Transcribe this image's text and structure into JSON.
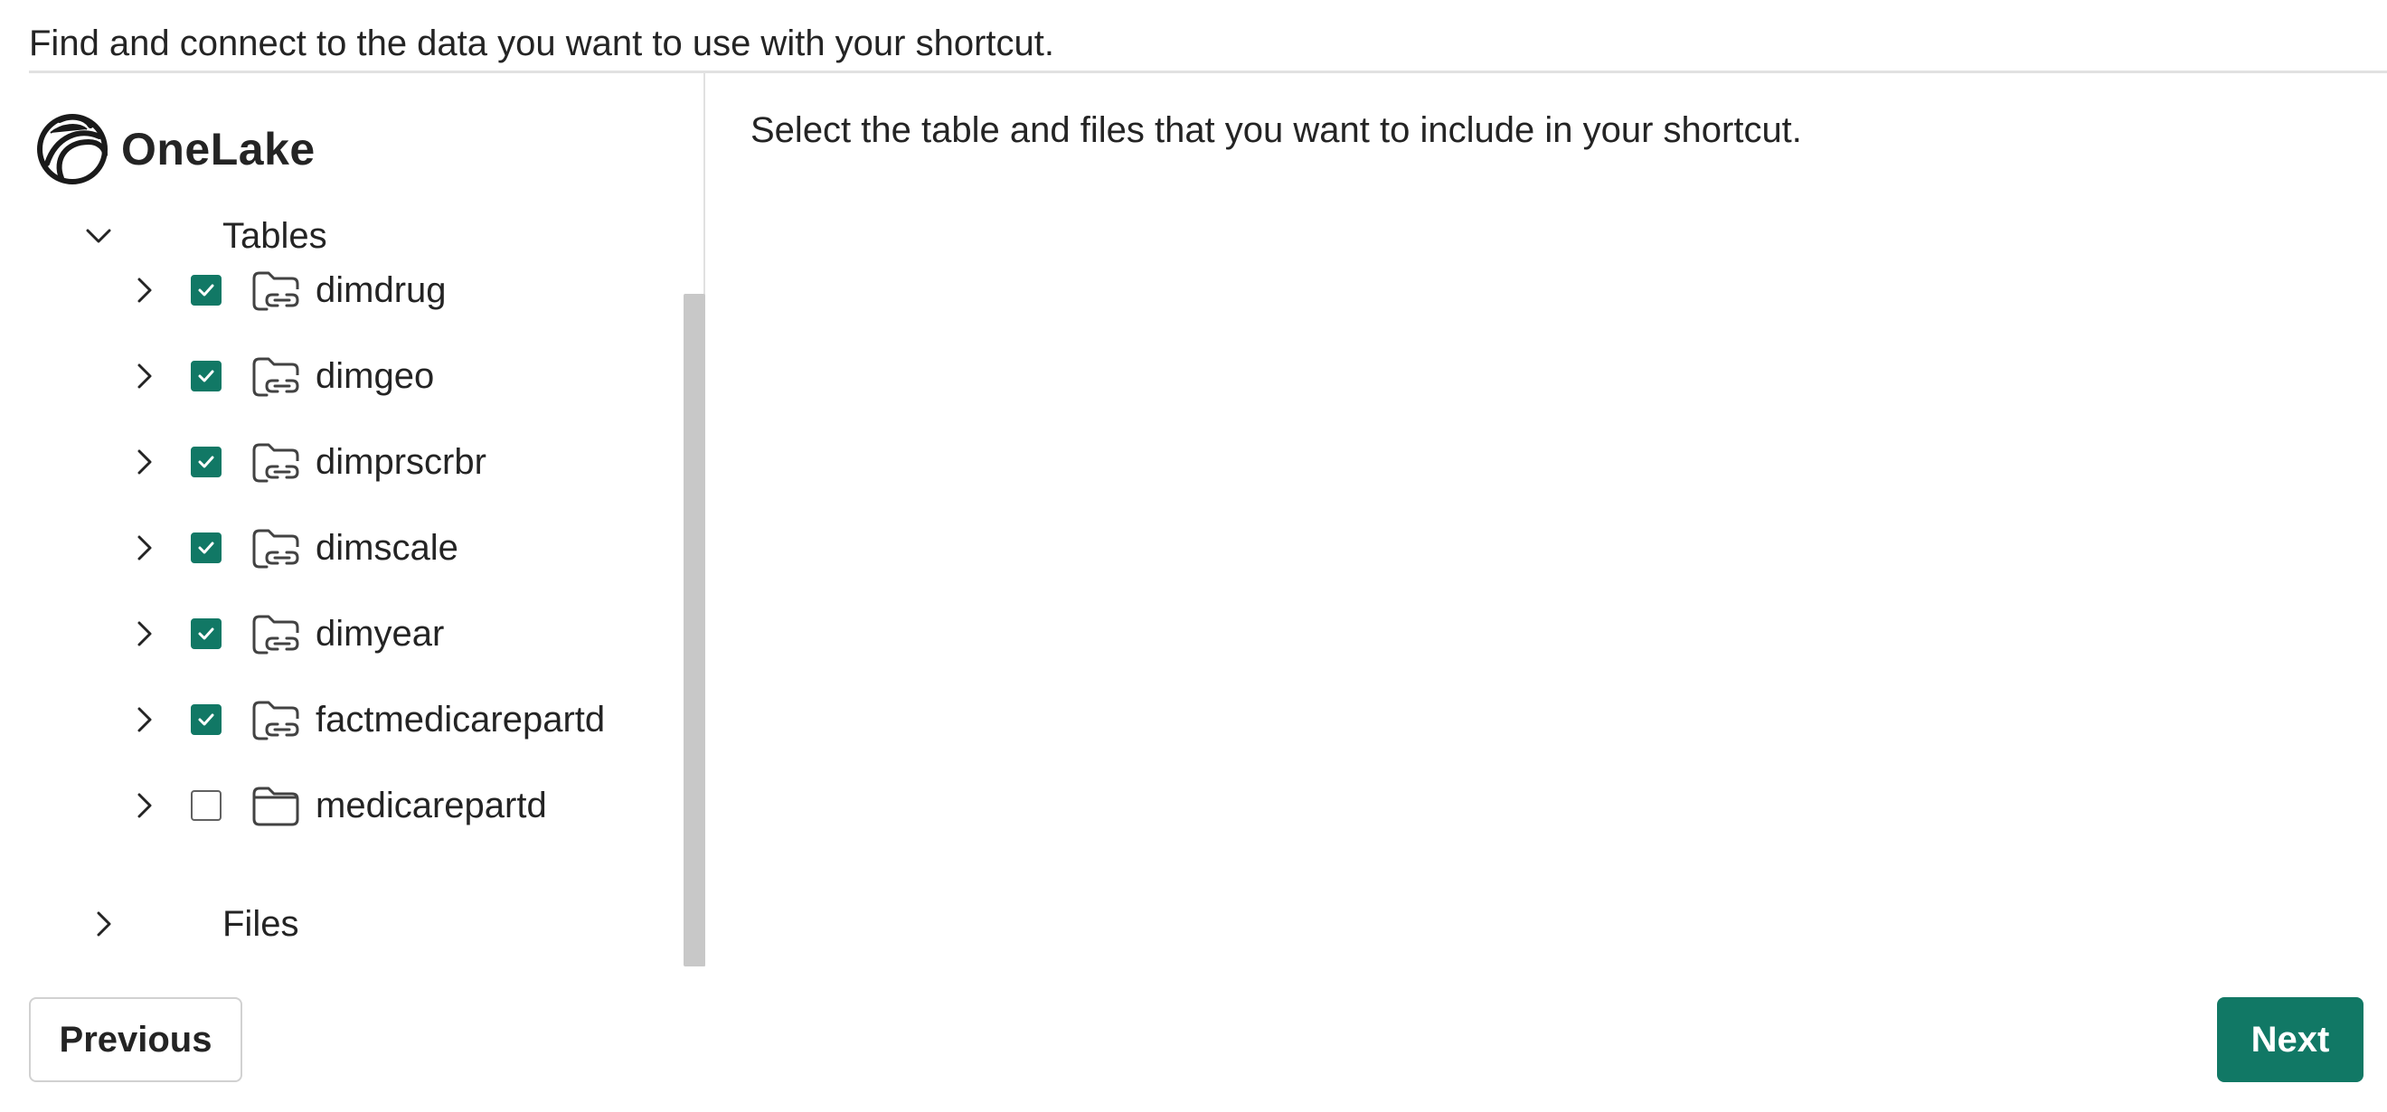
{
  "header": {
    "description": "Find and connect to the data you want to use with your shortcut."
  },
  "source": {
    "name": "OneLake",
    "logo_icon": "onelake-logo-icon"
  },
  "tree": {
    "tables_label": "Tables",
    "tables_expanded": true,
    "files_label": "Files",
    "files_expanded": false,
    "items": [
      {
        "label": "dimdrug",
        "checked": true,
        "icon": "folder-link-icon"
      },
      {
        "label": "dimgeo",
        "checked": true,
        "icon": "folder-link-icon"
      },
      {
        "label": "dimprscrbr",
        "checked": true,
        "icon": "folder-link-icon"
      },
      {
        "label": "dimscale",
        "checked": true,
        "icon": "folder-link-icon"
      },
      {
        "label": "dimyear",
        "checked": true,
        "icon": "folder-link-icon"
      },
      {
        "label": "factmedicarepartd",
        "checked": true,
        "icon": "folder-link-icon"
      },
      {
        "label": "medicarepartd",
        "checked": false,
        "icon": "folder-icon"
      }
    ]
  },
  "main": {
    "instructions": "Select the table and files that you want to include in your shortcut."
  },
  "footer": {
    "previous_label": "Previous",
    "next_label": "Next"
  },
  "colors": {
    "accent": "#117865",
    "text": "#242424",
    "divider": "#e1e1e1",
    "scrollbar": "#c8c8c8"
  }
}
